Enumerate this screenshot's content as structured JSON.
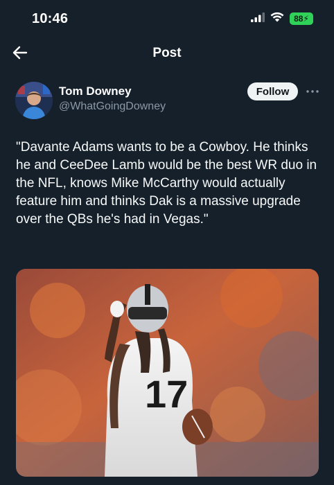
{
  "status_bar": {
    "time": "10:46",
    "battery": "88",
    "icons": [
      "signal-icon",
      "wifi-icon",
      "battery-charging-icon"
    ]
  },
  "nav": {
    "back_icon": "arrow-left-icon",
    "title": "Post"
  },
  "post": {
    "author_name": "Tom Downey",
    "author_handle": "@WhatGoingDowney",
    "follow_label": "Follow",
    "more_icon": "more-horizontal-icon",
    "text": "\"Davante Adams wants to be a Cowboy. He thinks he and CeeDee Lamb would be the best WR duo in the NFL, knows Mike McCarthy would actually feature him and thinks Dak is a massive upgrade over the QBs he's had in Vegas.\"",
    "media": {
      "jersey_number": "17"
    }
  },
  "colors": {
    "background": "#15202b",
    "secondary_text": "#8b98a5",
    "follow_bg": "#eff3f4",
    "battery": "#30d158"
  }
}
